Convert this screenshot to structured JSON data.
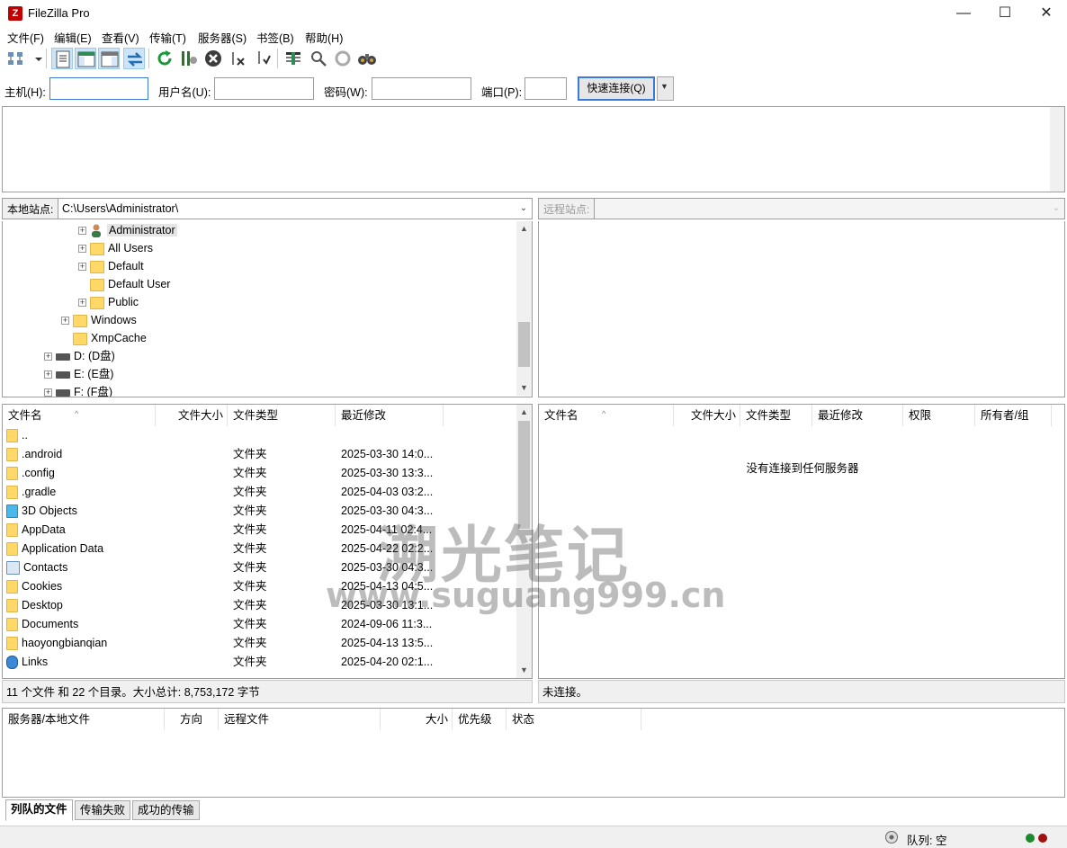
{
  "window": {
    "title": "FileZilla Pro",
    "icon_text": "Z",
    "minimize_glyph": "—",
    "maximize_glyph": "☐",
    "close_glyph": "✕"
  },
  "menu": [
    "文件(F)",
    "编辑(E)",
    "查看(V)",
    "传输(T)",
    "服务器(S)",
    "书签(B)",
    "帮助(H)"
  ],
  "toolbar": {
    "icons": [
      "site-manager-icon",
      "dropdown-arrow-icon",
      "toggle-message-log-icon",
      "toggle-local-tree-icon",
      "toggle-remote-tree-icon",
      "toggle-transfer-queue-icon",
      "refresh-icon",
      "process-queue-icon",
      "cancel-icon",
      "disconnect-icon",
      "reconnect-icon",
      "filter-icon",
      "compare-icon",
      "sync-browse-icon",
      "search-icon"
    ]
  },
  "quickconnect": {
    "host_label": "主机(H):",
    "host_value": "",
    "user_label": "用户名(U):",
    "user_value": "",
    "pass_label": "密码(W):",
    "pass_value": "",
    "port_label": "端口(P):",
    "port_value": "",
    "connect_button": "快速连接(Q)",
    "dropdown_glyph": "▼"
  },
  "local_site": {
    "label": "本地站点:",
    "path": "C:\\Users\\Administrator\\",
    "tree": [
      {
        "label": "Administrator",
        "icon": "user",
        "expandable": true
      },
      {
        "label": "All Users",
        "icon": "folder",
        "expandable": true
      },
      {
        "label": "Default",
        "icon": "folder",
        "expandable": true
      },
      {
        "label": "Default User",
        "icon": "folder",
        "expandable": false
      },
      {
        "label": "Public",
        "icon": "folder",
        "expandable": true
      },
      {
        "label": "Windows",
        "icon": "folder",
        "expandable": true
      },
      {
        "label": "XmpCache",
        "icon": "folder",
        "expandable": false
      },
      {
        "label": "D: (D盘)",
        "icon": "drive",
        "expandable": true
      },
      {
        "label": "E: (E盘)",
        "icon": "drive",
        "expandable": true
      },
      {
        "label": "F: (F盘)",
        "icon": "drive",
        "expandable": true
      }
    ]
  },
  "remote_site": {
    "label": "远程站点:",
    "path": ""
  },
  "local_list": {
    "columns": [
      "文件名",
      "文件大小",
      "文件类型",
      "最近修改"
    ],
    "rows": [
      {
        "name": "..",
        "type": "",
        "modified": ""
      },
      {
        "name": ".android",
        "type": "文件夹",
        "modified": "2025-03-30 14:0..."
      },
      {
        "name": ".config",
        "type": "文件夹",
        "modified": "2025-03-30 13:3..."
      },
      {
        "name": ".gradle",
        "type": "文件夹",
        "modified": "2025-04-03 03:2..."
      },
      {
        "name": "3D Objects",
        "type": "文件夹",
        "modified": "2025-03-30 04:3..."
      },
      {
        "name": "AppData",
        "type": "文件夹",
        "modified": "2025-04-11 02:4..."
      },
      {
        "name": "Application Data",
        "type": "文件夹",
        "modified": "2025-04-22 02:2..."
      },
      {
        "name": "Contacts",
        "type": "文件夹",
        "modified": "2025-03-30 04:3..."
      },
      {
        "name": "Cookies",
        "type": "文件夹",
        "modified": "2025-04-13 04:5..."
      },
      {
        "name": "Desktop",
        "type": "文件夹",
        "modified": "2025-03-30 13:1..."
      },
      {
        "name": "Documents",
        "type": "文件夹",
        "modified": "2024-09-06 11:3..."
      },
      {
        "name": "haoyongbianqian",
        "type": "文件夹",
        "modified": "2025-04-13 13:5..."
      },
      {
        "name": "Links",
        "type": "文件夹",
        "modified": "2025-04-20 02:1..."
      }
    ],
    "status": "11 个文件 和 22 个目录。大小总计: 8,753,172 字节"
  },
  "remote_list": {
    "columns": [
      "文件名",
      "文件大小",
      "文件类型",
      "最近修改",
      "权限",
      "所有者/组"
    ],
    "empty_message": "没有连接到任何服务器",
    "status": "未连接。"
  },
  "queue": {
    "columns": [
      "服务器/本地文件",
      "方向",
      "远程文件",
      "大小",
      "优先级",
      "状态"
    ],
    "tabs": [
      "列队的文件",
      "传输失败",
      "成功的传输"
    ],
    "status": "队列: 空"
  },
  "watermark": {
    "line1": "溯光笔记",
    "line2": "www.suguang999.cn"
  },
  "colors": {
    "accent": "#3b7ad6",
    "folder": "#ffd867",
    "brand": "#bf0000"
  }
}
